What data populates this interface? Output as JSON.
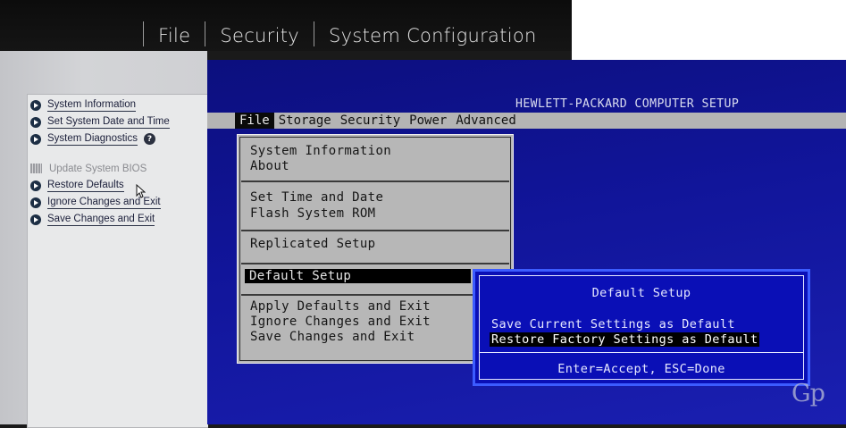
{
  "gui_bios": {
    "tabs": [
      "File",
      "Security",
      "System Configuration"
    ],
    "menu": [
      {
        "label": "System Information",
        "state": "enabled"
      },
      {
        "label": "Set System Date and Time",
        "state": "enabled"
      },
      {
        "label": "System Diagnostics",
        "state": "enabled",
        "help": "?"
      },
      {
        "label": "Update System BIOS",
        "state": "disabled"
      },
      {
        "label": "Restore Defaults",
        "state": "enabled"
      },
      {
        "label": "Ignore Changes and Exit",
        "state": "enabled"
      },
      {
        "label": "Save Changes and Exit",
        "state": "enabled"
      }
    ]
  },
  "classic_bios": {
    "title": "HEWLETT-PACKARD COMPUTER SETUP",
    "menubar": [
      "File",
      "Storage",
      "Security",
      "Power",
      "Advanced"
    ],
    "active_menu": "File",
    "file_menu": {
      "groups": [
        [
          "System Information",
          "About"
        ],
        [
          "Set Time and Date",
          "Flash System ROM"
        ],
        [
          "Replicated Setup"
        ],
        [
          "Default Setup"
        ],
        [
          "Apply Defaults and Exit",
          "Ignore Changes and Exit",
          "Save Changes and Exit"
        ]
      ],
      "selected": "Default Setup"
    },
    "dialog": {
      "title": "Default Setup",
      "options": [
        "Save Current Settings as Default",
        "Restore Factory Settings as Default"
      ],
      "selected": "Restore Factory Settings as Default",
      "hint": "Enter=Accept, ESC=Done"
    }
  },
  "watermark": "Gp",
  "colors": {
    "bios_blue": "#11159a",
    "menubar_gray": "#b4b4b4",
    "dialog_blue": "#0a0fb6",
    "gui_panel": "#d0d1d4"
  }
}
